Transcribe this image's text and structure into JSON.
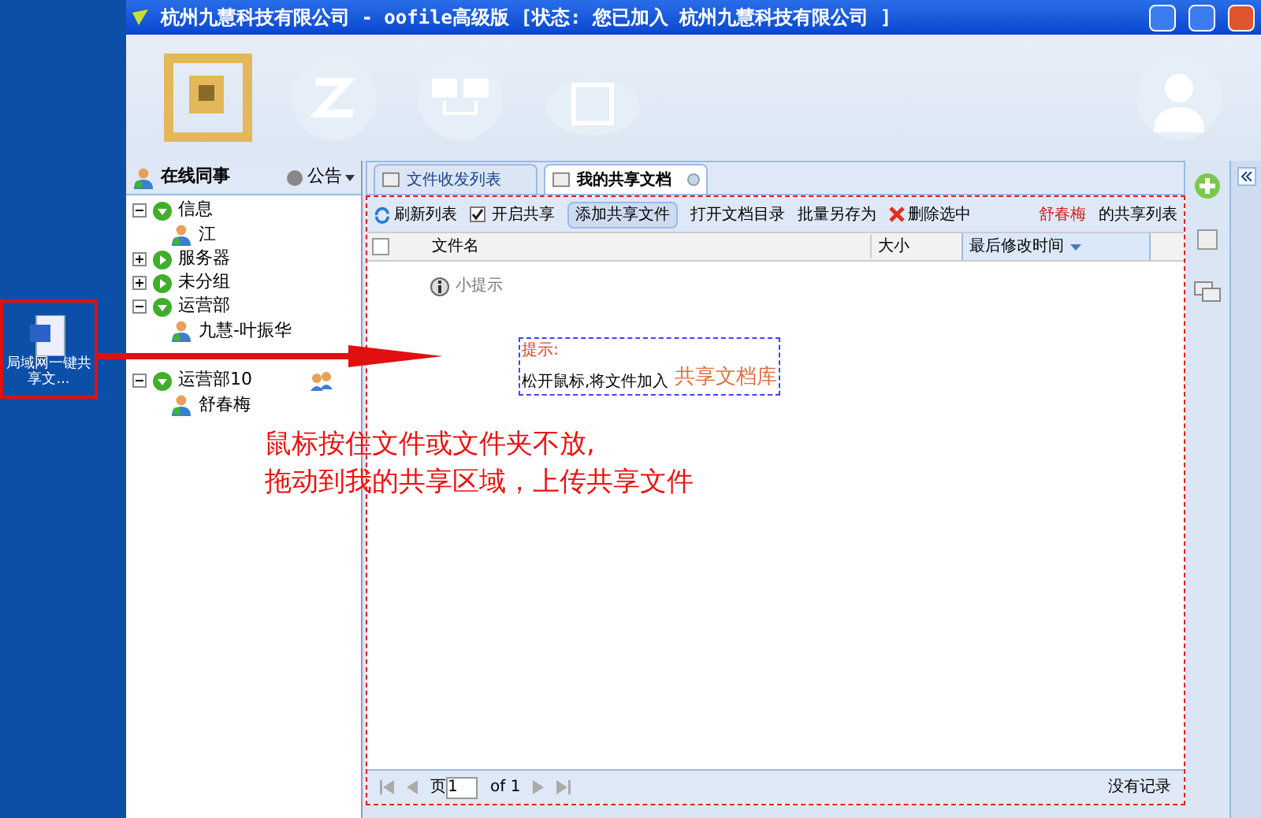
{
  "window": {
    "title": "杭州九慧科技有限公司 - oofile高级版 [状态: 您已加入 杭州九慧科技有限公司 ]"
  },
  "desktop_file": {
    "label": "局域网一键共享文..."
  },
  "sidebar": {
    "title": "在线同事",
    "notice": "公告",
    "tree": [
      {
        "label": "信息",
        "expanded": true,
        "shared": false,
        "children": [
          {
            "label": "江"
          }
        ]
      },
      {
        "label": "服务器",
        "expanded": false,
        "shared": false
      },
      {
        "label": "未分组",
        "expanded": false,
        "shared": false
      },
      {
        "label": "运营部",
        "expanded": true,
        "shared": false,
        "children": [
          {
            "label": "九慧-叶振华"
          }
        ]
      },
      {
        "label": "运营部10",
        "expanded": true,
        "shared": true,
        "children": [
          {
            "label": "舒春梅"
          }
        ]
      }
    ]
  },
  "tabs": [
    {
      "label": "文件收发列表",
      "selected": false,
      "closable": false
    },
    {
      "label": "我的共享文档",
      "selected": true,
      "closable": true
    }
  ],
  "toolbar": {
    "refresh": "刷新列表",
    "share_enabled": {
      "label": "开启共享",
      "checked": true
    },
    "add": "添加共享文件",
    "open_dir": "打开文档目录",
    "save_as": "批量另存为",
    "delete": "删除选中",
    "owner": "舒春梅",
    "owner_suffix": "的共享列表"
  },
  "table": {
    "select_all_checked": false,
    "columns": [
      "文件名",
      "大小",
      "最后修改时间"
    ]
  },
  "tip": {
    "title": "小提示",
    "heading": "提示:",
    "text": "松开鼠标,将文件加入",
    "target": "共享文档库"
  },
  "instruction": [
    "鼠标按住文件或文件夹不放,",
    "拖动到我的共享区域，上传共享文件"
  ],
  "pager": {
    "page_label": "页",
    "page": "1",
    "of": "of 1",
    "status": "没有记录"
  }
}
